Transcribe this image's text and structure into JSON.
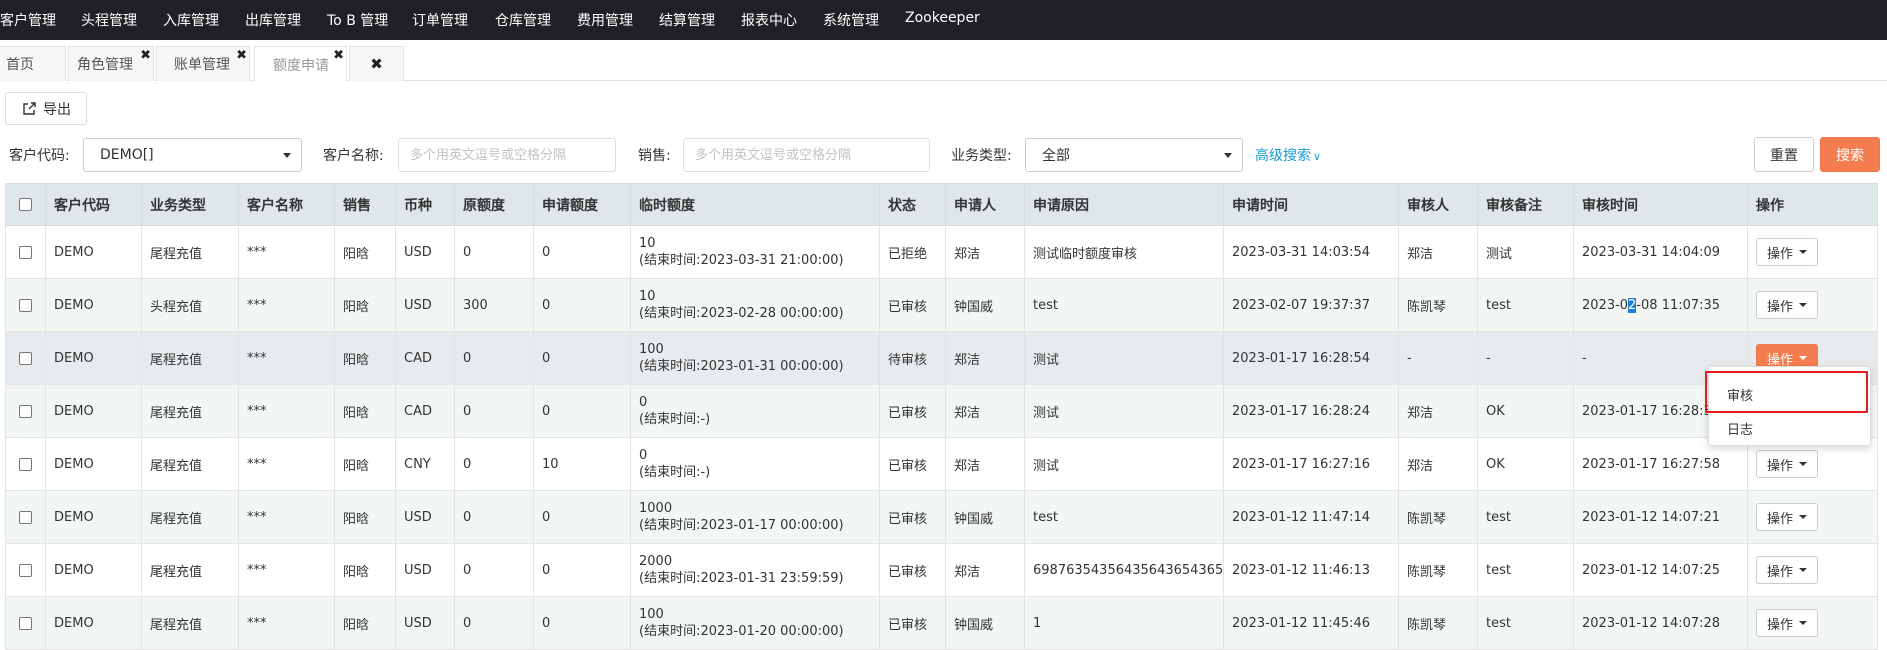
{
  "nav": {
    "items": [
      "客户管理",
      "头程管理",
      "入库管理",
      "出库管理",
      "To B 管理",
      "订单管理",
      "仓库管理",
      "费用管理",
      "结算管理",
      "报表中心",
      "系统管理",
      "Zookeeper"
    ]
  },
  "tabs": {
    "home": "首页",
    "role": "角色管理",
    "bill": "账单管理",
    "quota": "额度申请",
    "close_all": "✖",
    "close_mark": "✖"
  },
  "toolbar": {
    "export_label": "导出"
  },
  "filters": {
    "customer_code_label": "客户代码:",
    "customer_code_value": "DEMO[]",
    "customer_name_label": "客户名称:",
    "customer_name_placeholder": "多个用英文逗号或空格分隔",
    "sales_label": "销售:",
    "sales_placeholder": "多个用英文逗号或空格分隔",
    "business_type_label": "业务类型:",
    "business_type_value": "全部",
    "advanced_search": "高级搜索",
    "reset": "重置",
    "search": "搜索"
  },
  "table": {
    "headers": [
      "客户代码",
      "业务类型",
      "客户名称",
      "销售",
      "币种",
      "原额度",
      "申请额度",
      "临时额度",
      "状态",
      "申请人",
      "申请原因",
      "申请时间",
      "审核人",
      "审核备注",
      "审核时间",
      "操作"
    ],
    "op_label": "操作",
    "rows": [
      {
        "code": "DEMO",
        "type": "尾程充值",
        "name": "***",
        "sales": "阳晗",
        "currency": "USD",
        "orig": "0",
        "apply": "0",
        "temp": "10",
        "end": "(结束时间:2023-03-31 21:00:00)",
        "status": "已拒绝",
        "applicant": "郑洁",
        "reason": "测试临时额度审核",
        "apply_time": "2023-03-31 14:03:54",
        "reviewer": "郑洁",
        "remark": "测试",
        "review_time": "2023-03-31 14:04:09"
      },
      {
        "code": "DEMO",
        "type": "头程充值",
        "name": "***",
        "sales": "阳晗",
        "currency": "USD",
        "orig": "300",
        "apply": "0",
        "temp": "10",
        "end": "(结束时间:2023-02-28 00:00:00)",
        "status": "已审核",
        "applicant": "钟国威",
        "reason": "test",
        "apply_time": "2023-02-07 19:37:37",
        "reviewer": "陈凯琴",
        "remark": "test",
        "review_time_a": "2023-0",
        "review_time_b": "2",
        "review_time_c": "-08 11:07:35"
      },
      {
        "code": "DEMO",
        "type": "尾程充值",
        "name": "***",
        "sales": "阳晗",
        "currency": "CAD",
        "orig": "0",
        "apply": "0",
        "temp": "100",
        "end": "(结束时间:2023-01-31 00:00:00)",
        "status": "待审核",
        "applicant": "郑洁",
        "reason": "测试",
        "apply_time": "2023-01-17 16:28:54",
        "reviewer": "-",
        "remark": "-",
        "review_time": "-"
      },
      {
        "code": "DEMO",
        "type": "尾程充值",
        "name": "***",
        "sales": "阳晗",
        "currency": "CAD",
        "orig": "0",
        "apply": "0",
        "temp": "0",
        "end": "(结束时间:-)",
        "status": "已审核",
        "applicant": "郑洁",
        "reason": "测试",
        "apply_time": "2023-01-17 16:28:24",
        "reviewer": "郑洁",
        "remark": "OK",
        "review_time": "2023-01-17 16:28:32"
      },
      {
        "code": "DEMO",
        "type": "尾程充值",
        "name": "***",
        "sales": "阳晗",
        "currency": "CNY",
        "orig": "0",
        "apply": "10",
        "temp": "0",
        "end": "(结束时间:-)",
        "status": "已审核",
        "applicant": "郑洁",
        "reason": "测试",
        "apply_time": "2023-01-17 16:27:16",
        "reviewer": "郑洁",
        "remark": "OK",
        "review_time": "2023-01-17 16:27:58"
      },
      {
        "code": "DEMO",
        "type": "尾程充值",
        "name": "***",
        "sales": "阳晗",
        "currency": "USD",
        "orig": "0",
        "apply": "0",
        "temp": "1000",
        "end": "(结束时间:2023-01-17 00:00:00)",
        "status": "已审核",
        "applicant": "钟国威",
        "reason": "test",
        "apply_time": "2023-01-12 11:47:14",
        "reviewer": "陈凯琴",
        "remark": "test",
        "review_time": "2023-01-12 14:07:21"
      },
      {
        "code": "DEMO",
        "type": "尾程充值",
        "name": "***",
        "sales": "阳晗",
        "currency": "USD",
        "orig": "0",
        "apply": "0",
        "temp": "2000",
        "end": "(结束时间:2023-01-31 23:59:59)",
        "status": "已审核",
        "applicant": "郑洁",
        "reason": "69876354356435643654365",
        "apply_time": "2023-01-12 11:46:13",
        "reviewer": "陈凯琴",
        "remark": "test",
        "review_time": "2023-01-12 14:07:25"
      },
      {
        "code": "DEMO",
        "type": "尾程充值",
        "name": "***",
        "sales": "阳晗",
        "currency": "USD",
        "orig": "0",
        "apply": "0",
        "temp": "100",
        "end": "(结束时间:2023-01-20 00:00:00)",
        "status": "已审核",
        "applicant": "钟国威",
        "reason": "1",
        "apply_time": "2023-01-12 11:45:46",
        "reviewer": "陈凯琴",
        "remark": "test",
        "review_time": "2023-01-12 14:07:28"
      }
    ]
  },
  "dropdown": {
    "approve": "审核",
    "log": "日志"
  }
}
